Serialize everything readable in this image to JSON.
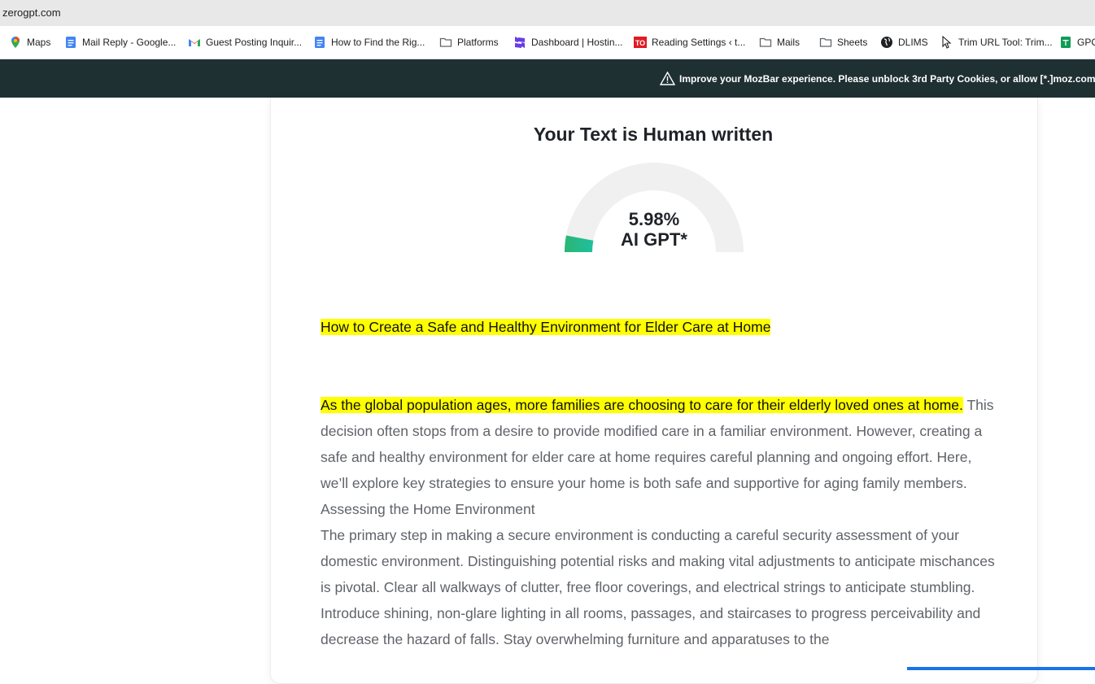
{
  "browser": {
    "url": "zerogpt.com",
    "bookmarks": [
      {
        "label": "Maps",
        "icon": "maps-icon"
      },
      {
        "label": "Mail Reply - Google...",
        "icon": "google-docs-icon"
      },
      {
        "label": "Guest Posting Inquir...",
        "icon": "gmail-icon"
      },
      {
        "label": "How to Find the Rig...",
        "icon": "google-docs-icon"
      },
      {
        "label": "Platforms",
        "icon": "folder-icon"
      },
      {
        "label": "Dashboard | Hostin...",
        "icon": "hostinger-icon"
      },
      {
        "label": "Reading Settings ‹ t...",
        "icon": "to-icon"
      },
      {
        "label": "Mails",
        "icon": "folder-icon"
      },
      {
        "label": "Sheets",
        "icon": "folder-icon"
      },
      {
        "label": "DLIMS",
        "icon": "globe-icon"
      },
      {
        "label": "Trim URL Tool: Trim...",
        "icon": "cursor-icon"
      },
      {
        "label": "GPC",
        "icon": "google-sheets-icon"
      }
    ]
  },
  "mozbar": {
    "message": "Improve your MozBar experience. Please unblock 3rd Party Cookies, or allow [*.]moz.com in y"
  },
  "result": {
    "title": "Your Text is Human written",
    "percentage_label": "5.98%",
    "metric_label": "AI GPT*",
    "ai_fraction": 0.0598,
    "colors": {
      "gauge_track": "#f0f0f0",
      "gauge_fill_start": "#2bb673",
      "gauge_fill_end": "#1fbfa0",
      "highlight": "#ffff00"
    }
  },
  "text": {
    "heading": "How to Create a Safe and Healthy Environment for Elder Care at Home",
    "intro_highlight": "As the global population ages, more families are choosing to care for their elderly loved ones at home.",
    "intro_rest": "This decision often stops from a desire to provide modified care in a familiar environment. However, creating a safe and healthy environment for elder care at home requires careful planning and ongoing effort. Here, we’ll explore key strategies to ensure your home is both safe and supportive for aging family members.",
    "subheading": "Assessing the Home Environment",
    "para2": "The primary step in making a secure environment is conducting a careful security assessment of your domestic environment. Distinguishing potential risks and making vital adjustments to anticipate mischances is pivotal. Clear all walkways of clutter, free floor coverings, and electrical strings to anticipate stumbling. Introduce shining, non-glare lighting in all rooms, passages, and staircases to progress perceivability and decrease the hazard of falls. Stay overwhelming furniture and apparatuses to the"
  }
}
